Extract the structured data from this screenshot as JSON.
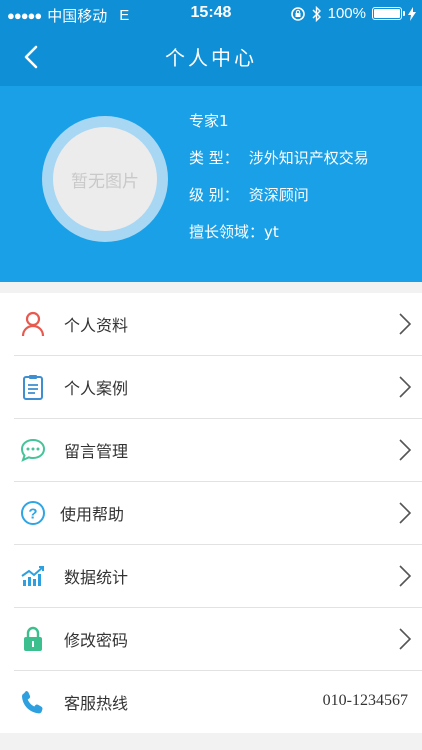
{
  "status_bar": {
    "carrier": "中国移动",
    "network": "E",
    "time": "15:48",
    "battery": "100%",
    "battery_level": 1.0
  },
  "nav": {
    "title": "个人中心",
    "back_icon": "chevron-left-icon"
  },
  "profile": {
    "avatar_placeholder": "暂无图片",
    "name": "专家1",
    "type_label": "类 型：",
    "type_value": "涉外知识产权交易",
    "level_label": "级 别：",
    "level_value": "资深顾问",
    "field_label": "擅长领域：",
    "field_value": "yt"
  },
  "menu": [
    {
      "label": "个人资料",
      "icon": "person-icon",
      "color": "#e8594f"
    },
    {
      "label": "个人案例",
      "icon": "clipboard-icon",
      "color": "#3d8fd1"
    },
    {
      "label": "留言管理",
      "icon": "chat-bubble-icon",
      "color": "#46c39a"
    },
    {
      "label": "使用帮助",
      "icon": "help-circle-icon",
      "color": "#2ea5e4"
    },
    {
      "label": "数据统计",
      "icon": "chart-icon",
      "color": "#2e9fdf"
    },
    {
      "label": "修改密码",
      "icon": "lock-icon",
      "color": "#3cbf8f"
    },
    {
      "label": "客服热线",
      "icon": "phone-icon",
      "color": "#2e9fdf",
      "value": "010-1234567"
    }
  ],
  "colors": {
    "primary": "#0e8fd6",
    "header_bg": "#1aa0e6"
  }
}
